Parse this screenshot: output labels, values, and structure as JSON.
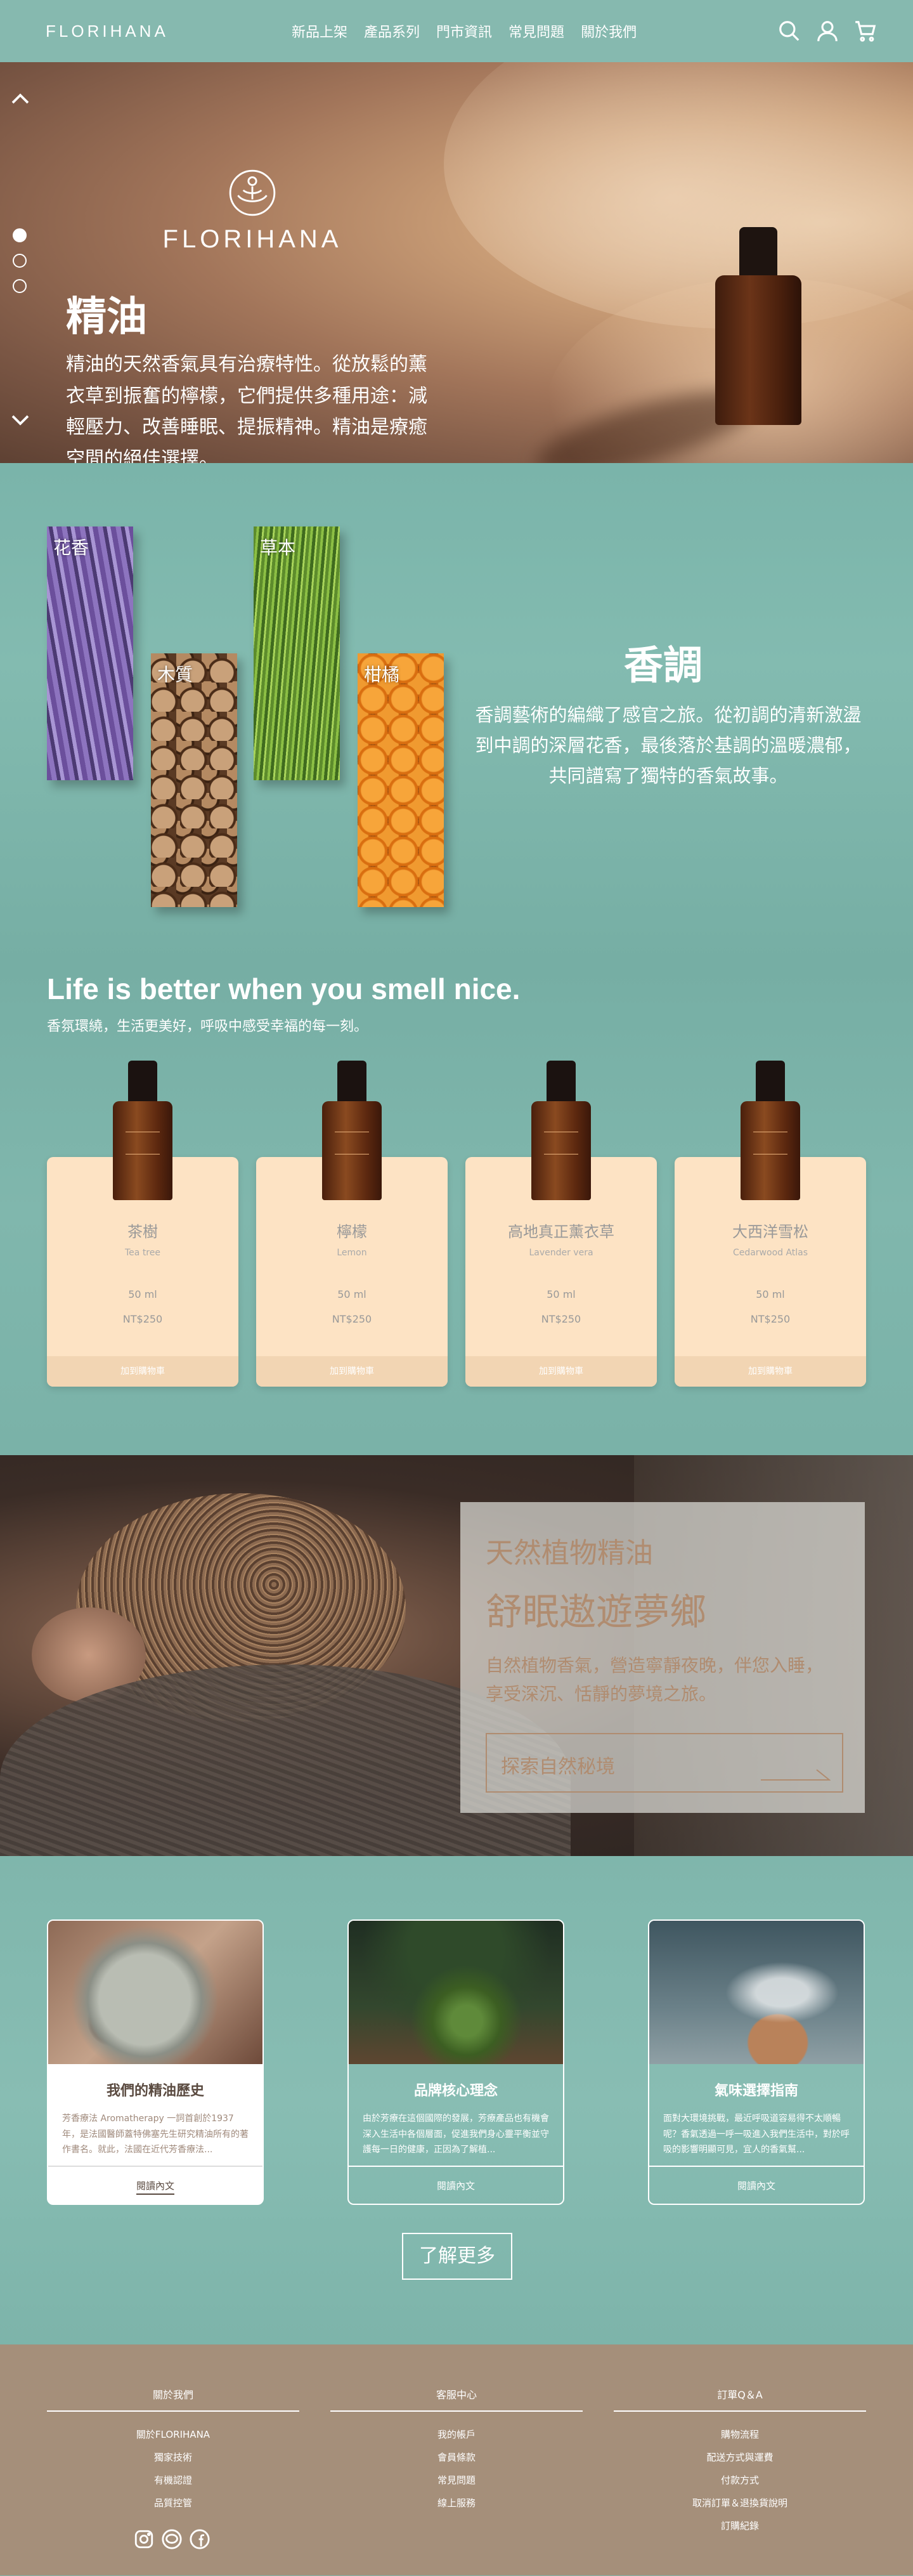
{
  "brand": "FLORIHANA",
  "nav": {
    "items": [
      "新品上架",
      "產品系列",
      "門市資訊",
      "常見問題",
      "關於我們"
    ]
  },
  "hero": {
    "logo_word": "FLORIHANA",
    "title": "精油",
    "description": "精油的天然香氣具有治療特性。從放鬆的薰衣草到振奮的檸檬，它們提供多種用途：減輕壓力、改善睡眠、提振精神。精油是療癒空間的絕佳選擇。"
  },
  "scents": {
    "cards": [
      "花香",
      "木質",
      "草本",
      "柑橘"
    ],
    "heading": "香調",
    "description": "香調藝術的編織了感官之旅。從初調的清新激盪到中調的深層花香，最後落於基調的溫暖濃郁，共同譜寫了獨特的香氣故事。"
  },
  "products": {
    "tagline": "Life is better when you smell nice.",
    "subtagline": "香氛環繞，生活更美好，呼吸中感受幸福的每一刻。",
    "items": [
      {
        "name": "茶樹",
        "latin": "Tea tree",
        "volume": "50 ml",
        "price": "NT$250",
        "add": "加到購物車"
      },
      {
        "name": "檸檬",
        "latin": "Lemon",
        "volume": "50 ml",
        "price": "NT$250",
        "add": "加到購物車"
      },
      {
        "name": "高地真正薰衣草",
        "latin": "Lavender vera",
        "volume": "50 ml",
        "price": "NT$250",
        "add": "加到購物車"
      },
      {
        "name": "大西洋雪松",
        "latin": "Cedarwood Atlas",
        "volume": "50 ml",
        "price": "NT$250",
        "add": "加到購物車"
      }
    ]
  },
  "sleep": {
    "title1": "天然植物精油",
    "title2": "舒眠遨遊夢鄉",
    "description": "自然植物香氣，營造寧靜夜晚，伴您入睡，享受深沉、恬靜的夢境之旅。",
    "button": "探索自然秘境"
  },
  "articles": {
    "items": [
      {
        "title": "我們的精油歷史",
        "text": "芳香療法 Aromatherapy 一詞首創於1937年，是法國醫師蓋特佛塞先生研究精油所有的著作書名。就此，法國在近代芳香療法...",
        "more": "閱讀內文"
      },
      {
        "title": "品牌核心理念",
        "text": "由於芳療在這個國際的發展，芳療產品也有機會深入生活中各個層面，促進我們身心靈平衡並守護每一日的健康，正因為了解植...",
        "more": "閱讀內文"
      },
      {
        "title": "氣味選擇指南",
        "text": "面對大環境挑戰，最近呼吸道容易得不太順暢呢？香氣透過一呼一吸進入我們生活中，對於呼吸的影響明顯可見，宜人的香氣幫...",
        "more": "閱讀內文"
      }
    ],
    "learn_more": "了解更多"
  },
  "footer": {
    "columns": [
      {
        "heading": "關於我們",
        "links": [
          "關於FLORIHANA",
          "獨家技術",
          "有機認證",
          "品質控管"
        ]
      },
      {
        "heading": "客服中心",
        "links": [
          "我的帳戶",
          "會員條款",
          "常見問題",
          "線上服務"
        ]
      },
      {
        "heading": "訂單Q＆A",
        "links": [
          "購物流程",
          "配送方式與運費",
          "付款方式",
          "取消訂單＆退換貨說明",
          "訂購紀錄"
        ]
      }
    ]
  }
}
